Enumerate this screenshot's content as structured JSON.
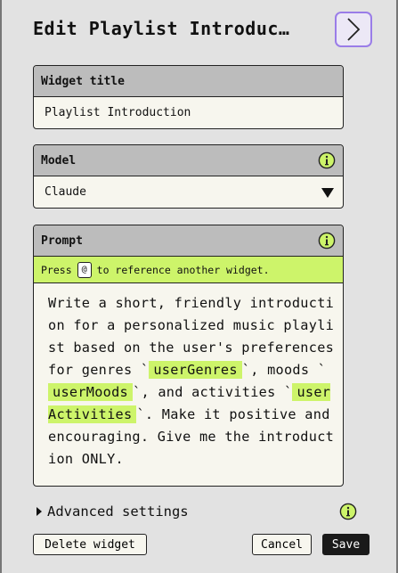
{
  "header": {
    "title": "Edit Playlist Introduc…",
    "next_icon": "chevron-right-icon"
  },
  "widget_title": {
    "label": "Widget title",
    "value": "Playlist Introduction"
  },
  "model": {
    "label": "Model",
    "info_icon": "info-icon",
    "selected": "Claude",
    "dropdown_icon": "triangle-down-icon"
  },
  "prompt": {
    "label": "Prompt",
    "info_icon": "info-icon",
    "hint_before": "Press",
    "hint_key": "@",
    "hint_after": "to reference another widget.",
    "text_1": "Write a short, friendly introduction for a personalized music playlist based on the user's preferences for genres `",
    "var_1": "userGenres",
    "text_2": "`, moods `",
    "var_2": "userMoods",
    "text_3": "`, and activities `",
    "var_3": "userActivities",
    "text_4": "`. Make it positive and encouraging. Give me the introduction ONLY."
  },
  "advanced": {
    "label": "Advanced settings",
    "info_icon": "info-icon"
  },
  "buttons": {
    "delete": "Delete widget",
    "cancel": "Cancel",
    "save": "Save"
  },
  "colors": {
    "accent_lime": "#cdf46a",
    "nav_border_purple": "#9a7de8",
    "panel_header": "#bcbcbc",
    "background": "#e2e2e2"
  }
}
